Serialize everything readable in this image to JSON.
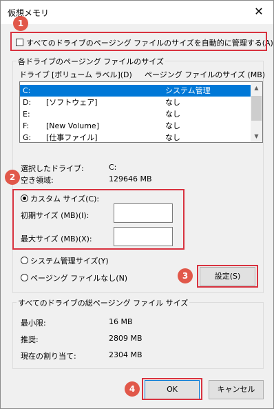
{
  "window": {
    "title": "仮想メモリ",
    "close_glyph": "✕"
  },
  "annotations": [
    "1",
    "2",
    "3",
    "4"
  ],
  "auto_manage_label": "すべてのドライブのページング ファイルのサイズを自動的に管理する(A)",
  "drives_group": {
    "title": "各ドライブのページング ファイルのサイズ",
    "col_drive": "ドライブ",
    "col_volume": "[ボリューム ラベル](D)",
    "col_size": "ページング ファイルのサイズ (MB)",
    "rows": [
      {
        "drive": "C:",
        "label": "",
        "size": "システム管理",
        "selected": true
      },
      {
        "drive": "D:",
        "label": "[ソフトウェア]",
        "size": "なし",
        "selected": false
      },
      {
        "drive": "E:",
        "label": "",
        "size": "なし",
        "selected": false
      },
      {
        "drive": "F:",
        "label": "[New Volume]",
        "size": "なし",
        "selected": false
      },
      {
        "drive": "G:",
        "label": "[仕事ファイル]",
        "size": "なし",
        "selected": false
      }
    ],
    "selected_drive_label": "選択したドライブ:",
    "selected_drive_value": "C:",
    "free_space_label": "空き領域:",
    "free_space_value": "129646 MB",
    "custom_size_label": "カスタム サイズ(C):",
    "initial_size_label": "初期サイズ (MB)(I):",
    "initial_size_value": "",
    "max_size_label": "最大サイズ (MB)(X):",
    "max_size_value": "",
    "system_managed_label": "システム管理サイズ(Y)",
    "no_paging_label": "ページング ファイルなし(N)",
    "set_button": "設定(S)"
  },
  "total_group": {
    "title": "すべてのドライブの総ページング ファイル サイズ",
    "min_label": "最小限:",
    "min_value": "16 MB",
    "recommended_label": "推奨:",
    "recommended_value": "2809 MB",
    "current_label": "現在の割り当て:",
    "current_value": "2304 MB"
  },
  "buttons": {
    "ok": "OK",
    "cancel": "キャンセル"
  },
  "colors": {
    "annotation": "#e1584a",
    "highlight_border": "#d8323f",
    "selection": "#0078d7"
  }
}
